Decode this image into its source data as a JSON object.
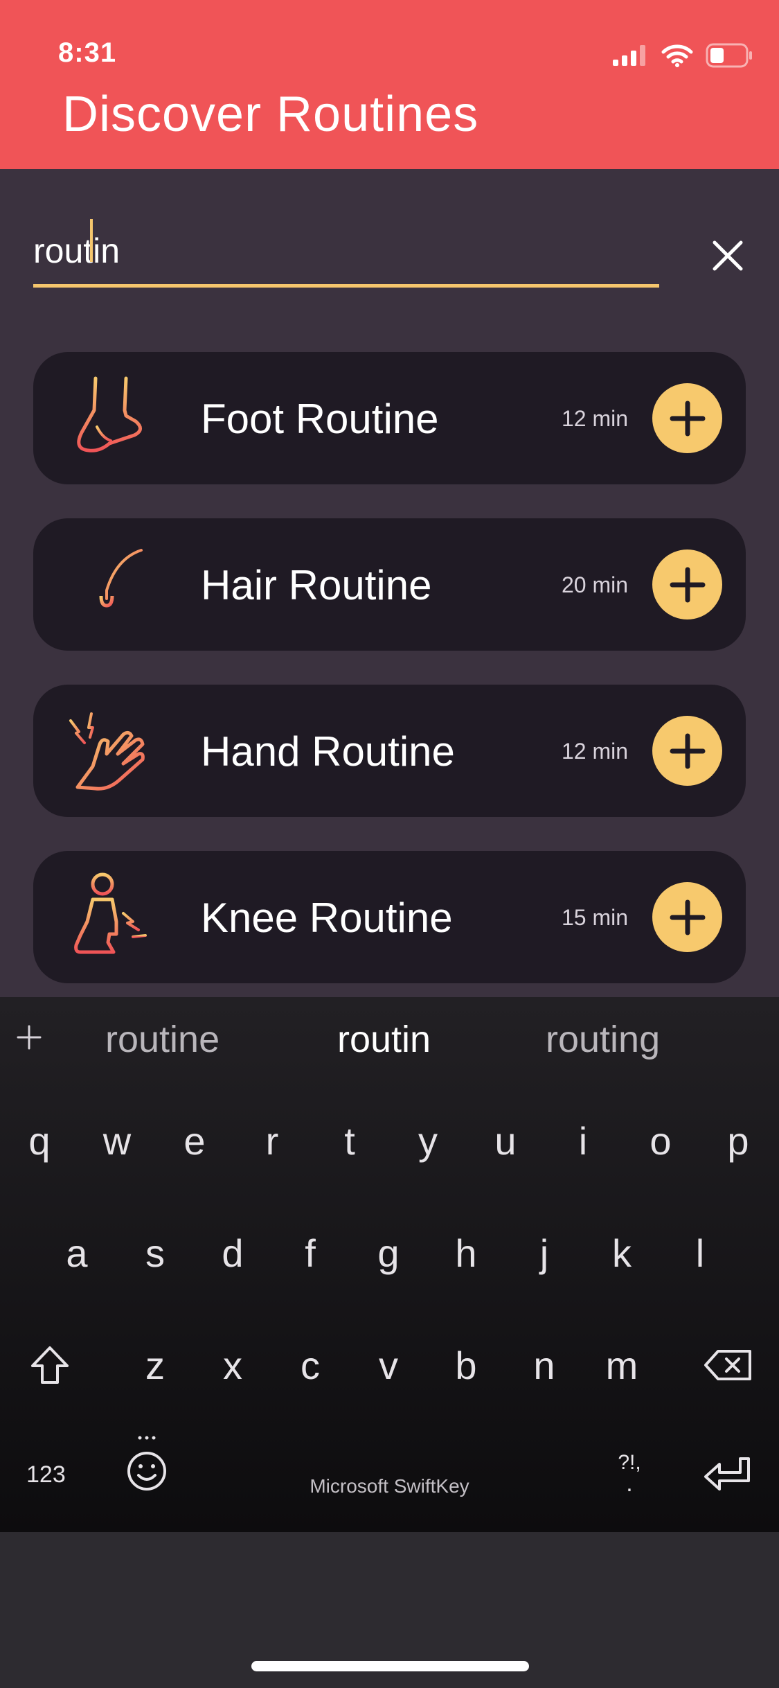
{
  "status_bar": {
    "time": "8:31"
  },
  "header": {
    "title": "Discover Routines",
    "background_color": "#f05457"
  },
  "search": {
    "value": "routin",
    "clear_icon": "close-icon",
    "underline_color": "#f5c66d"
  },
  "routines": [
    {
      "name": "Foot Routine",
      "duration": "12 min",
      "icon": "foot-icon"
    },
    {
      "name": "Hair Routine",
      "duration": "20 min",
      "icon": "hair-follicle-icon"
    },
    {
      "name": "Hand Routine",
      "duration": "12 min",
      "icon": "hand-pain-icon"
    },
    {
      "name": "Knee Routine",
      "duration": "15 min",
      "icon": "knee-pain-icon"
    }
  ],
  "keyboard": {
    "suggestions": [
      "routine",
      "routin",
      "routing"
    ],
    "row1": [
      "q",
      "w",
      "e",
      "r",
      "t",
      "y",
      "u",
      "i",
      "o",
      "p"
    ],
    "row2": [
      "a",
      "s",
      "d",
      "f",
      "g",
      "h",
      "j",
      "k",
      "l"
    ],
    "row3": [
      "z",
      "x",
      "c",
      "v",
      "b",
      "n",
      "m"
    ],
    "numbers_label": "123",
    "punctuation_label": "?!,",
    "punctuation_dot": ".",
    "brand": "Microsoft SwiftKey",
    "accent_color": "#f7c96d"
  }
}
